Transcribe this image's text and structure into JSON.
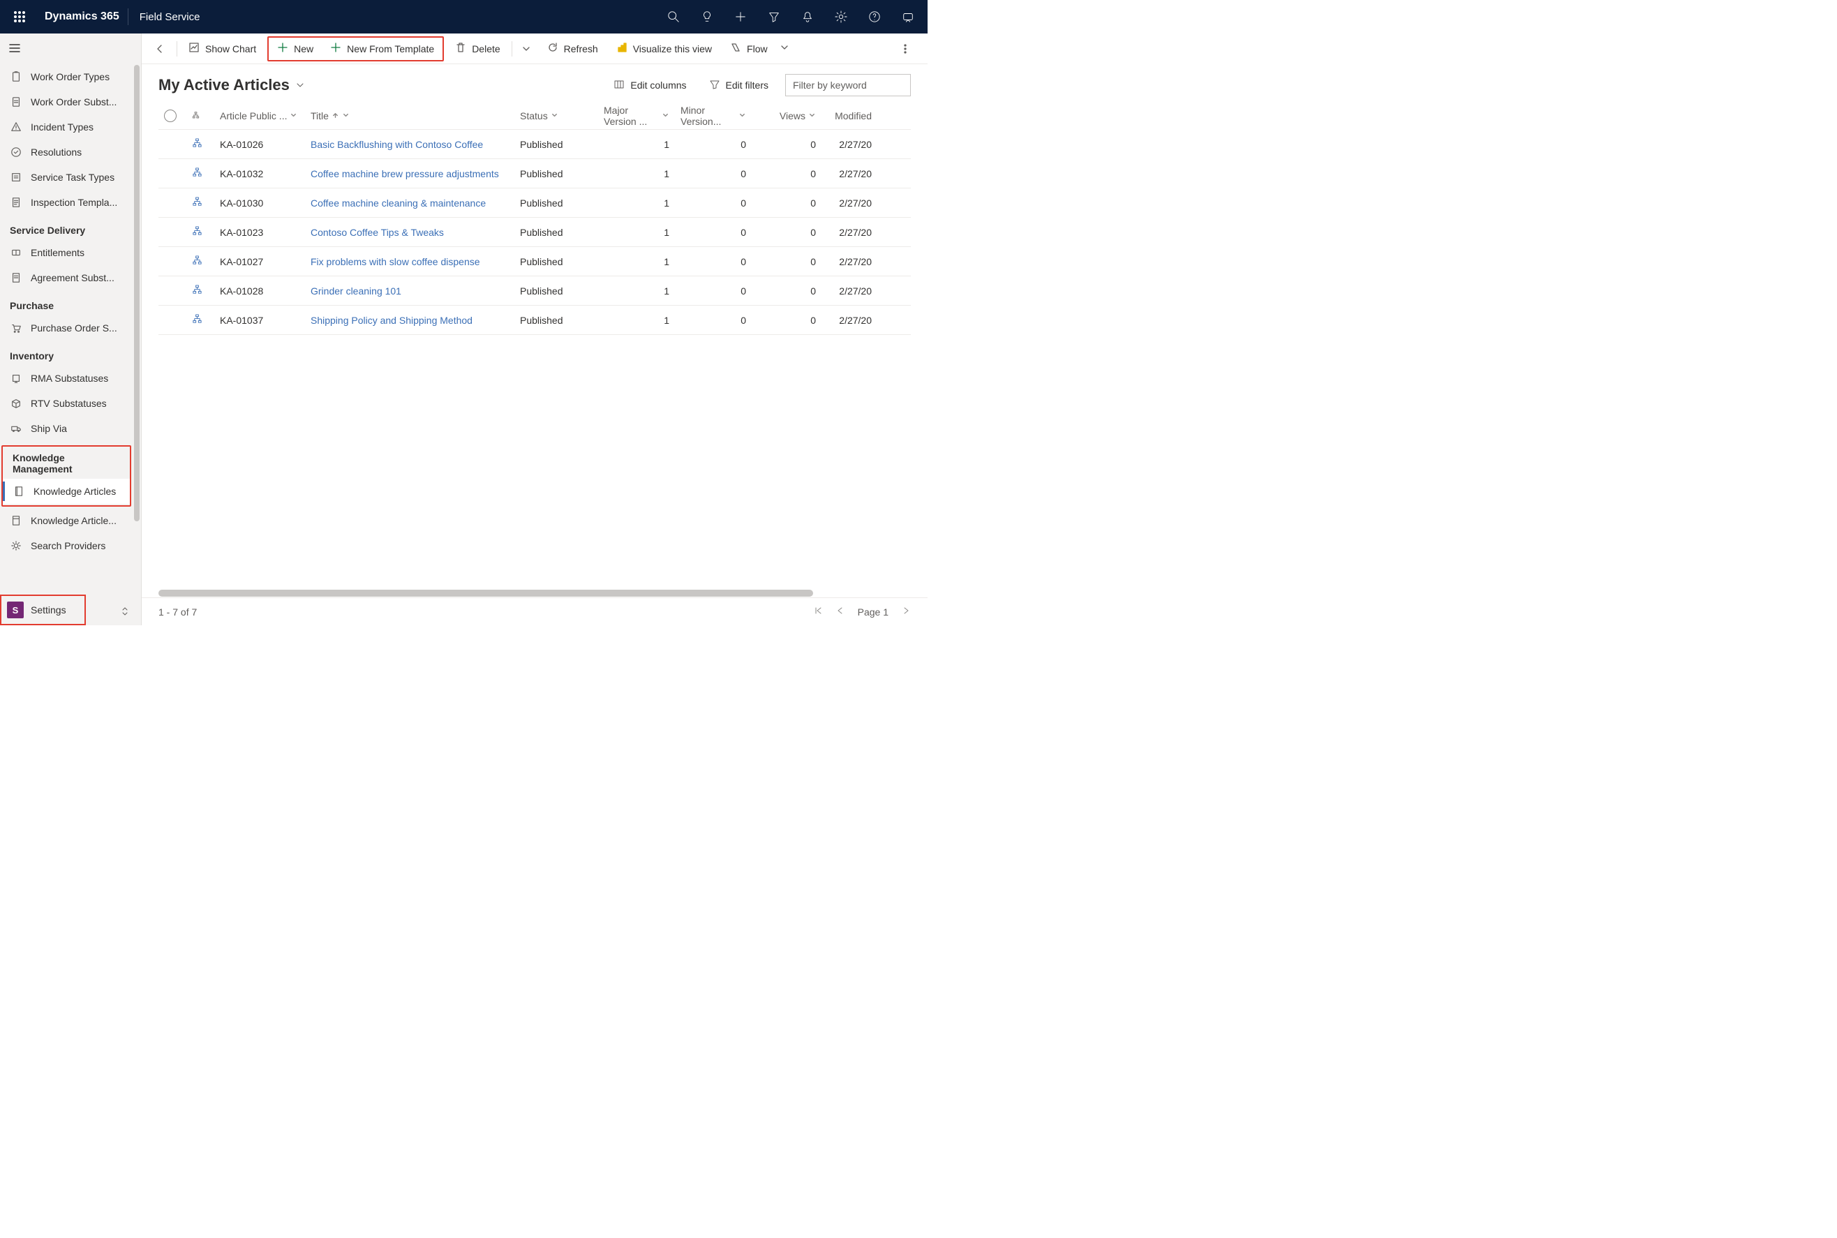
{
  "topbar": {
    "brand": "Dynamics 365",
    "module": "Field Service"
  },
  "sidebar": {
    "items0": [
      {
        "label": "Work Order Types"
      },
      {
        "label": "Work Order Subst..."
      },
      {
        "label": "Incident Types"
      },
      {
        "label": "Resolutions"
      },
      {
        "label": "Service Task Types"
      },
      {
        "label": "Inspection Templa..."
      }
    ],
    "group1": "Service Delivery",
    "items1": [
      {
        "label": "Entitlements"
      },
      {
        "label": "Agreement Subst..."
      }
    ],
    "group2": "Purchase",
    "items2": [
      {
        "label": "Purchase Order S..."
      }
    ],
    "group3": "Inventory",
    "items3": [
      {
        "label": "RMA Substatuses"
      },
      {
        "label": "RTV Substatuses"
      },
      {
        "label": "Ship Via"
      }
    ],
    "group4": "Knowledge Management",
    "items4": [
      {
        "label": "Knowledge Articles"
      },
      {
        "label": "Knowledge Article..."
      },
      {
        "label": "Search Providers"
      }
    ],
    "bottom": {
      "badge": "S",
      "label": "Settings"
    }
  },
  "cmdbar": {
    "showChart": "Show Chart",
    "new": "New",
    "newFromTemplate": "New From Template",
    "delete": "Delete",
    "refresh": "Refresh",
    "visualize": "Visualize this view",
    "flow": "Flow"
  },
  "view": {
    "title": "My Active Articles",
    "editColumns": "Edit columns",
    "editFilters": "Edit filters",
    "filterPlaceholder": "Filter by keyword"
  },
  "grid": {
    "headers": {
      "pub": "Article Public ...",
      "title": "Title",
      "status": "Status",
      "major": "Major Version ...",
      "minor": "Minor Version...",
      "views": "Views",
      "modified": "Modified"
    },
    "rows": [
      {
        "pub": "KA-01026",
        "title": "Basic Backflushing with Contoso Coffee",
        "status": "Published",
        "major": "1",
        "minor": "0",
        "views": "0",
        "mod": "2/27/20"
      },
      {
        "pub": "KA-01032",
        "title": "Coffee machine brew pressure adjustments",
        "status": "Published",
        "major": "1",
        "minor": "0",
        "views": "0",
        "mod": "2/27/20"
      },
      {
        "pub": "KA-01030",
        "title": "Coffee machine cleaning & maintenance",
        "status": "Published",
        "major": "1",
        "minor": "0",
        "views": "0",
        "mod": "2/27/20"
      },
      {
        "pub": "KA-01023",
        "title": "Contoso Coffee Tips & Tweaks",
        "status": "Published",
        "major": "1",
        "minor": "0",
        "views": "0",
        "mod": "2/27/20"
      },
      {
        "pub": "KA-01027",
        "title": "Fix problems with slow coffee dispense",
        "status": "Published",
        "major": "1",
        "minor": "0",
        "views": "0",
        "mod": "2/27/20"
      },
      {
        "pub": "KA-01028",
        "title": "Grinder cleaning 101",
        "status": "Published",
        "major": "1",
        "minor": "0",
        "views": "0",
        "mod": "2/27/20"
      },
      {
        "pub": "KA-01037",
        "title": "Shipping Policy and Shipping Method",
        "status": "Published",
        "major": "1",
        "minor": "0",
        "views": "0",
        "mod": "2/27/20"
      }
    ]
  },
  "footer": {
    "count": "1 - 7 of 7",
    "page": "Page 1"
  }
}
